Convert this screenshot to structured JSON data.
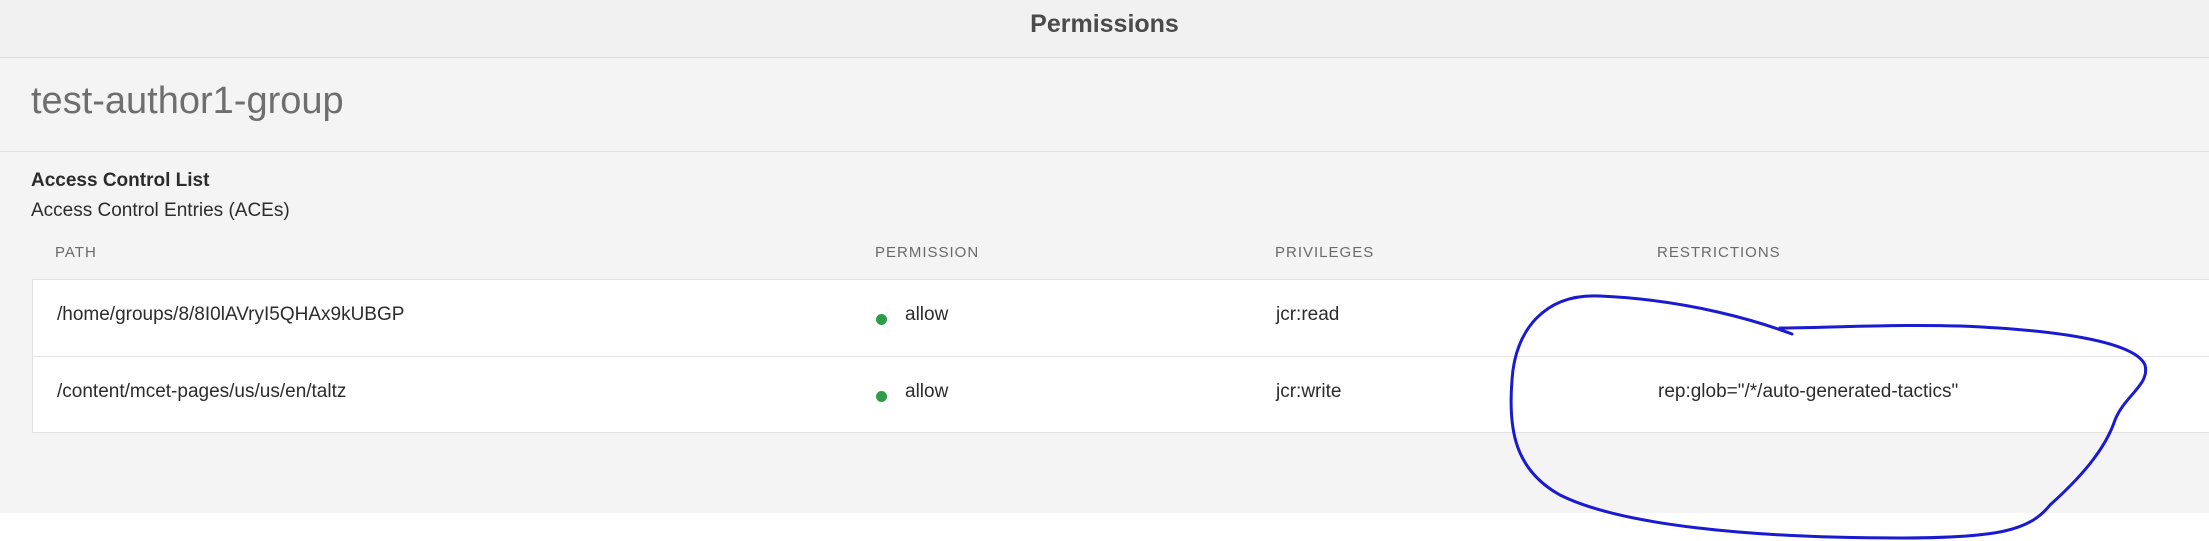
{
  "topbar": {
    "title": "Permissions"
  },
  "group": {
    "name": "test-author1-group"
  },
  "acl": {
    "heading": "Access Control List",
    "subheading": "Access Control Entries (ACEs)",
    "columns": {
      "path": "PATH",
      "permission": "PERMISSION",
      "privileges": "PRIVILEGES",
      "restrictions": "RESTRICTIONS"
    },
    "rows": [
      {
        "path": "/home/groups/8/8I0lAVryI5QHAx9kUBGP",
        "permission": "allow",
        "privileges": "jcr:read",
        "restrictions": ""
      },
      {
        "path": "/content/mcet-pages/us/us/en/taltz",
        "permission": "allow",
        "privileges": "jcr:write",
        "restrictions": "rep:glob=\"/*/auto-generated-tactics\""
      }
    ]
  },
  "colors": {
    "allow_status": "#2d9d4a",
    "annotation_ink": "#1a1ad0"
  }
}
